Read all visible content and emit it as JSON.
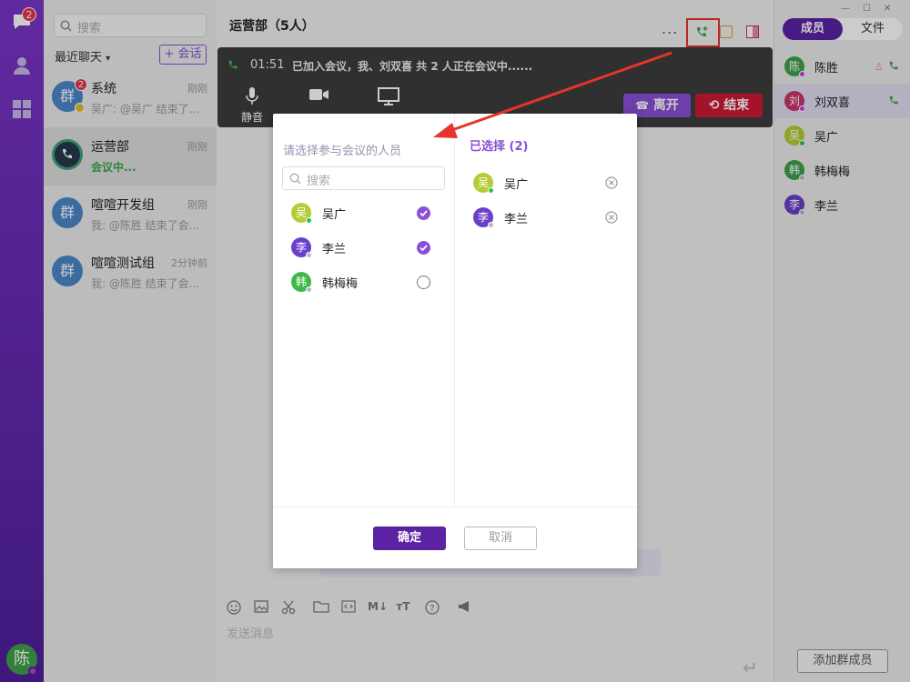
{
  "rail": {
    "badge": "2",
    "self_avatar": "陈"
  },
  "chatlist": {
    "search_placeholder": "搜索",
    "recent_label": "最近聊天",
    "new_chat_label": "+ 会话",
    "items": [
      {
        "avatar": "群",
        "badge": "2",
        "name": "系统",
        "time": "刚刚",
        "msg": "吴广: @吴广 结束了..."
      },
      {
        "avatar": "",
        "name": "运营部",
        "time": "刚刚",
        "msg": "会议中..."
      },
      {
        "avatar": "群",
        "name": "喧喧开发组",
        "time": "刚刚",
        "msg": "我: @陈胜 结束了会..."
      },
      {
        "avatar": "群",
        "name": "喧喧测试组",
        "time": "2分钟前",
        "msg": "我: @陈胜 结束了会..."
      }
    ]
  },
  "main": {
    "title": "运营部（5人）",
    "more_label": "...",
    "call": {
      "time": "01:51",
      "status": "已加入会议，我、刘双喜 共 2 人正在会议中......",
      "mute_label": "静音",
      "leave_label": "离开",
      "end_label": "结束"
    },
    "input_placeholder": "发送消息"
  },
  "members": {
    "tab_members": "成员",
    "tab_files": "文件",
    "list": [
      {
        "avatar": "陈",
        "name": "陈胜",
        "color": "#3fa14a",
        "status": "#c33fd8"
      },
      {
        "avatar": "刘",
        "name": "刘双喜",
        "color": "#c9356a",
        "status": "#c33fd8"
      },
      {
        "avatar": "吴",
        "name": "吴广",
        "color": "#b5cc35",
        "status": "#2fc24a"
      },
      {
        "avatar": "韩",
        "name": "韩梅梅",
        "color": "#3fa14a",
        "status": "#bbbbbb"
      },
      {
        "avatar": "李",
        "name": "李兰",
        "color": "#6a3fc9",
        "status": "#bbbbbb"
      }
    ],
    "add_member_label": "添加群成员"
  },
  "dialog": {
    "left_title": "请选择参与会议的人员",
    "search_placeholder": "搜索",
    "candidates": [
      {
        "avatar": "吴",
        "name": "吴广",
        "color": "#b5cc35",
        "status": "#2fc24a",
        "checked": true
      },
      {
        "avatar": "李",
        "name": "李兰",
        "color": "#6a3fc9",
        "status": "#bbbbbb",
        "checked": true
      },
      {
        "avatar": "韩",
        "name": "韩梅梅",
        "color": "#3fb84a",
        "status": "#bbbbbb",
        "checked": false
      }
    ],
    "right_title": "已选择 (2)",
    "selected": [
      {
        "avatar": "吴",
        "name": "吴广",
        "color": "#b5cc35",
        "status": "#2fc24a"
      },
      {
        "avatar": "李",
        "name": "李兰",
        "color": "#6a3fc9",
        "status": "#bbbbbb"
      }
    ],
    "ok_label": "确定",
    "cancel_label": "取消"
  },
  "colors": {
    "accent": "#5b22a3",
    "highlight": "#e8332c"
  }
}
